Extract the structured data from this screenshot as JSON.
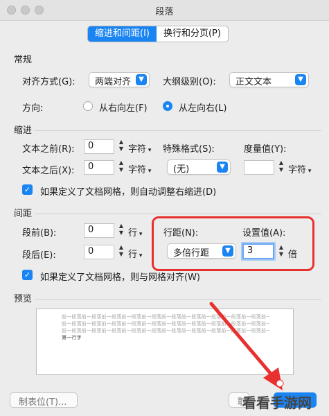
{
  "window": {
    "title": "段落"
  },
  "tabs": [
    {
      "label": "缩进和间距(I)",
      "active": true
    },
    {
      "label": "换行和分页(P)",
      "active": false
    }
  ],
  "general": {
    "heading": "常规",
    "align_label": "对齐方式(G):",
    "align_value": "两端对齐",
    "outline_label": "大纲级别(O):",
    "outline_value": "正文文本",
    "direction_label": "方向:",
    "dir_rtl": "从右向左(F)",
    "dir_ltr": "从左向右(L)"
  },
  "indent": {
    "heading": "缩进",
    "before_label": "文本之前(R):",
    "before_value": "0",
    "before_unit": "字符",
    "after_label": "文本之后(X):",
    "after_value": "0",
    "after_unit": "字符",
    "special_label": "特殊格式(S):",
    "special_value": "(无)",
    "measure_label": "度量值(Y):",
    "measure_value": "",
    "measure_unit": "字符",
    "auto_adjust": "如果定义了文档网格，则自动调整右缩进(D)"
  },
  "spacing": {
    "heading": "间距",
    "before_label": "段前(B):",
    "before_value": "0",
    "before_unit": "行",
    "after_label": "段后(E):",
    "after_value": "0",
    "after_unit": "行",
    "line_label": "行距(N):",
    "line_value": "多倍行距",
    "setting_label": "设置值(A):",
    "setting_value": "3",
    "setting_unit": "倍",
    "grid_align": "如果定义了文档网格，则与网格对齐(W)"
  },
  "preview": {
    "heading": "预览",
    "prev_lines": [
      "前一段落前一段落前一段落前一段落前一段落前一段落前一段落前一段落前一段落前一段落前一段落",
      "前一段落前一段落前一段落前一段落前一段落前一段落前一段落前一段落前一段落前一段落前一段落",
      "前一段落前一段落前一段落前一段落前一段落前一段落前一段落前一段落前一段落前一段落前一段落"
    ],
    "sample_line": "第一行字"
  },
  "footer": {
    "tabs_button": "制表位(T)...",
    "cancel_button": "取"
  },
  "watermark": "看看手游网",
  "colors": {
    "accent": "#1a84f2",
    "highlight": "#e8312e"
  }
}
